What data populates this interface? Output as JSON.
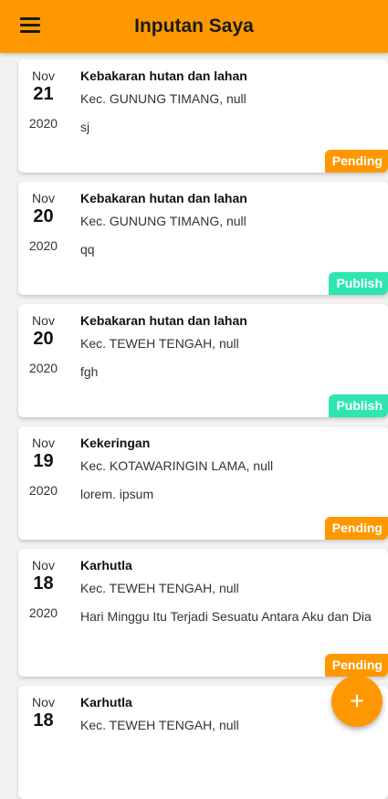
{
  "appbar": {
    "title": "Inputan Saya",
    "menu_icon": "hamburger-menu-icon"
  },
  "items": [
    {
      "month": "Nov",
      "day": "21",
      "year": "2020",
      "title": "Kebakaran hutan dan lahan",
      "location": "Kec. GUNUNG TIMANG, null",
      "description": "sj",
      "status": "Pending"
    },
    {
      "month": "Nov",
      "day": "20",
      "year": "2020",
      "title": "Kebakaran hutan dan lahan",
      "location": "Kec. GUNUNG TIMANG, null",
      "description": "qq",
      "status": "Publish"
    },
    {
      "month": "Nov",
      "day": "20",
      "year": "2020",
      "title": "Kebakaran hutan dan lahan",
      "location": "Kec. TEWEH TENGAH, null",
      "description": "fgh",
      "status": "Publish"
    },
    {
      "month": "Nov",
      "day": "19",
      "year": "2020",
      "title": "Kekeringan",
      "location": "Kec. KOTAWARINGIN LAMA, null",
      "description": "lorem. ipsum",
      "status": "Pending"
    },
    {
      "month": "Nov",
      "day": "18",
      "year": "2020",
      "title": "Karhutla",
      "location": "Kec. TEWEH TENGAH, null",
      "description": "Hari Minggu Itu Terjadi Sesuatu Antara Aku dan Dia",
      "status": "Pending"
    },
    {
      "month": "Nov",
      "day": "18",
      "year": "",
      "title": "Karhutla",
      "location": "Kec. TEWEH TENGAH, null",
      "description": "",
      "status": ""
    }
  ],
  "fab": {
    "label": "+",
    "icon": "plus-icon"
  },
  "colors": {
    "accent": "#ff9800",
    "publish": "#2ee6b0"
  }
}
